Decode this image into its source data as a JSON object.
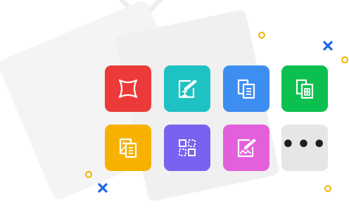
{
  "tiles": [
    {
      "icon": "crop-shape-icon",
      "color": "#ec3a3a"
    },
    {
      "icon": "edit-text-icon",
      "color": "#1ec2c2"
    },
    {
      "icon": "document-copy-icon",
      "color": "#3d8ef0"
    },
    {
      "icon": "table-copy-icon",
      "color": "#0cc04f"
    },
    {
      "icon": "image-copy-icon",
      "color": "#f7b100"
    },
    {
      "icon": "select-grid-icon",
      "color": "#7b61f0"
    },
    {
      "icon": "signature-icon",
      "color": "#e45fdc"
    },
    {
      "icon": "more-dots-icon",
      "color": "#e6e6e6"
    }
  ],
  "more": {
    "label": "•••"
  },
  "decorations": {
    "ring_color": "#f5b400",
    "cross_color": "#1a66e0",
    "card_color": "#f3f3f3"
  }
}
